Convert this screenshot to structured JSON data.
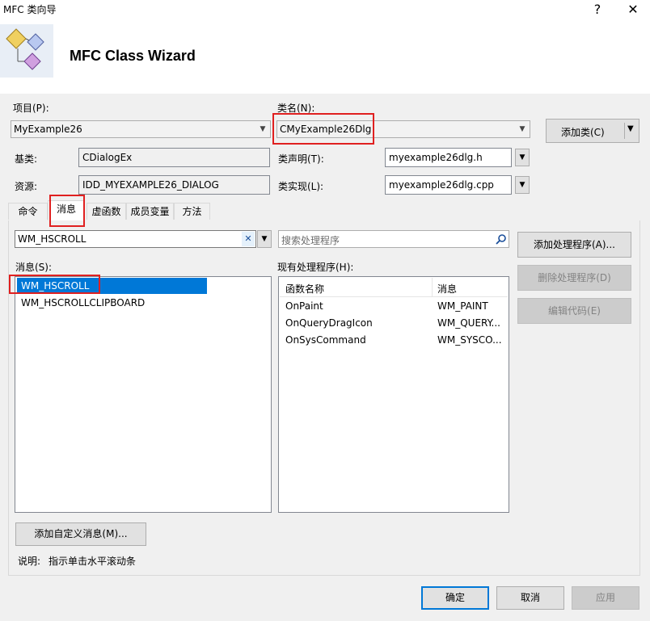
{
  "window": {
    "title": "MFC 类向导",
    "help_glyph": "?",
    "close_glyph": "✕"
  },
  "banner": {
    "title": "MFC Class Wizard"
  },
  "project": {
    "label": "项目(P):",
    "value": "MyExample26"
  },
  "class_name": {
    "label": "类名(N):",
    "value": "CMyExample26Dlg"
  },
  "add_class_button": "添加类(C)",
  "base_class": {
    "label": "基类:",
    "value": "CDialogEx"
  },
  "resource": {
    "label": "资源:",
    "value": "IDD_MYEXAMPLE26_DIALOG"
  },
  "class_declaration": {
    "label": "类声明(T):",
    "value": "myexample26dlg.h"
  },
  "class_implementation": {
    "label": "类实现(L):",
    "value": "myexample26dlg.cpp"
  },
  "tabs": [
    "命令",
    "消息",
    "虚函数",
    "成员变量",
    "方法"
  ],
  "active_tab": "消息",
  "message_filter": {
    "value": "WM_HSCROLL",
    "clear_glyph": "✕"
  },
  "search": {
    "placeholder": "搜索处理程序"
  },
  "messages": {
    "label": "消息(S):",
    "items": [
      "WM_HSCROLL",
      "WM_HSCROLLCLIPBOARD"
    ],
    "selected": "WM_HSCROLL"
  },
  "handlers": {
    "label": "现有处理程序(H):",
    "columns": [
      "函数名称",
      "消息"
    ],
    "rows": [
      [
        "OnPaint",
        "WM_PAINT"
      ],
      [
        "OnQueryDragIcon",
        "WM_QUERY..."
      ],
      [
        "OnSysCommand",
        "WM_SYSCO..."
      ]
    ]
  },
  "buttons": {
    "add_handler": "添加处理程序(A)...",
    "delete_handler": "删除处理程序(D)",
    "edit_code": "编辑代码(E)",
    "add_custom_message": "添加自定义消息(M)...",
    "ok": "确定",
    "cancel": "取消",
    "apply": "应用"
  },
  "description": {
    "label": "说明:",
    "text": "指示单击水平滚动条"
  },
  "colors": {
    "highlight_red": "#e02020",
    "selection_blue": "#0078d7"
  }
}
